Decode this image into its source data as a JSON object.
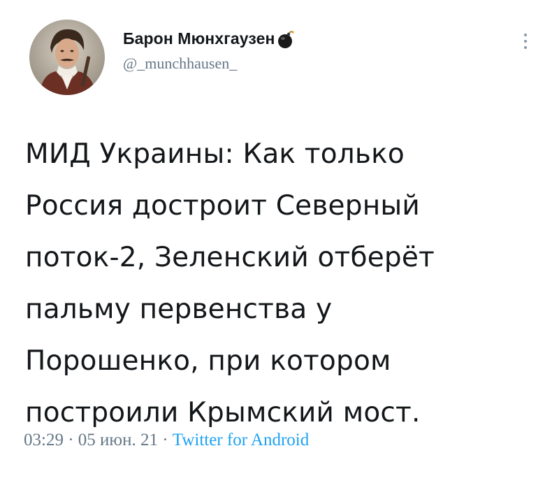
{
  "author": {
    "display_name": "Барон Мюнхгаузен",
    "handle": "@_munchhausen_"
  },
  "tweet": {
    "text": "МИД Украины: Как только\nРоссия достроит Северный\nпоток-2, Зеленский отберёт\nпальму первенства у\nПорошенко, при котором\nпостроили Крымский мост.",
    "time": "03:29",
    "separator": "·",
    "date": "05 июн. 21",
    "source": "Twitter for Android"
  },
  "icons": {
    "name_emoji": "bomb-icon",
    "menu": "more-vertical-icon"
  },
  "colors": {
    "text": "#14171a",
    "secondary": "#657786",
    "link": "#1da1f2"
  }
}
